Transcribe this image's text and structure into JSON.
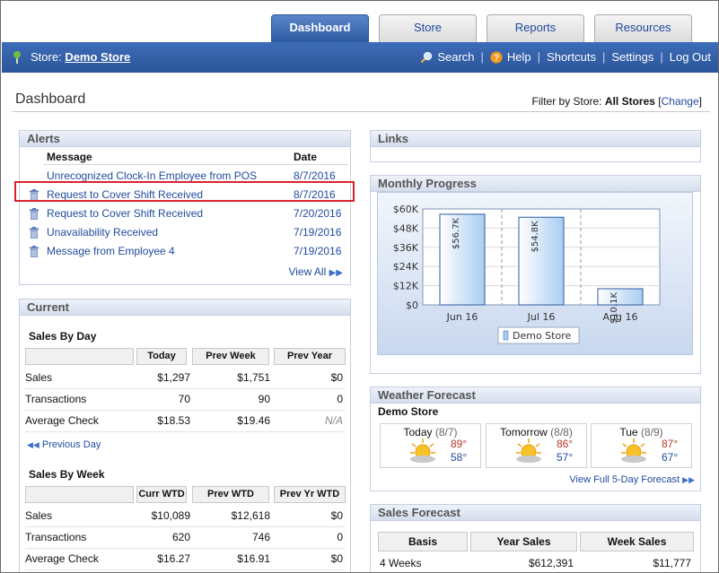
{
  "tabs": [
    {
      "label": "Dashboard",
      "active": true
    },
    {
      "label": "Store",
      "active": false
    },
    {
      "label": "Reports",
      "active": false
    },
    {
      "label": "Resources",
      "active": false
    }
  ],
  "nav": {
    "store_prefix": "Store:",
    "store_name": "Demo Store",
    "search": "Search",
    "help": "Help",
    "shortcuts": "Shortcuts",
    "settings": "Settings",
    "logout": "Log Out",
    "sep": "|"
  },
  "page": {
    "title": "Dashboard",
    "filter_prefix": "Filter by Store:",
    "filter_value": "All Stores",
    "filter_open": "[",
    "filter_change": "Change",
    "filter_close": "]"
  },
  "alerts": {
    "title": "Alerts",
    "col_message": "Message",
    "col_date": "Date",
    "rows": [
      {
        "message": "Unrecognized Clock-In Employee from POS",
        "date": "8/7/2016",
        "trash": false
      },
      {
        "message": "Request to Cover Shift Received",
        "date": "8/7/2016",
        "trash": true
      },
      {
        "message": "Request to Cover Shift Received",
        "date": "7/20/2016",
        "trash": true
      },
      {
        "message": "Unavailability Received",
        "date": "7/19/2016",
        "trash": true
      },
      {
        "message": "Message from Employee 4",
        "date": "7/19/2016",
        "trash": true
      }
    ],
    "view_all": "View All"
  },
  "links": {
    "title": "Links"
  },
  "current": {
    "title": "Current",
    "by_day": {
      "title": "Sales By Day",
      "headers": [
        "Today",
        "Prev Week",
        "Prev Year"
      ],
      "rows": [
        {
          "label": "Sales",
          "v": [
            "$1,297",
            "$1,751",
            "$0"
          ]
        },
        {
          "label": "Transactions",
          "v": [
            "70",
            "90",
            "0"
          ]
        },
        {
          "label": "Average Check",
          "v": [
            "$18.53",
            "$19.46",
            "N/A"
          ]
        }
      ],
      "prev_link": "Previous Day"
    },
    "by_week": {
      "title": "Sales By Week",
      "headers": [
        "Curr WTD",
        "Prev WTD",
        "Prev Yr WTD"
      ],
      "rows": [
        {
          "label": "Sales",
          "v": [
            "$10,089",
            "$12,618",
            "$0"
          ]
        },
        {
          "label": "Transactions",
          "v": [
            "620",
            "746",
            "0"
          ]
        },
        {
          "label": "Average Check",
          "v": [
            "$16.27",
            "$16.91",
            "$0"
          ]
        }
      ]
    }
  },
  "monthly": {
    "title": "Monthly Progress"
  },
  "chart_data": {
    "type": "bar",
    "categories": [
      "Jun 16",
      "Jul 16",
      "Aug 16"
    ],
    "series": [
      {
        "name": "Demo Store",
        "values": [
          56.7,
          54.8,
          10.1
        ]
      }
    ],
    "data_labels": [
      "$56.7K",
      "$54.8K",
      "$10.1K"
    ],
    "y_ticks": [
      "$0",
      "$12K",
      "$24K",
      "$36K",
      "$48K",
      "$60K"
    ],
    "ylim": [
      0,
      60
    ],
    "grid": true,
    "legend": "bottom-center"
  },
  "weather": {
    "title": "Weather Forecast",
    "store": "Demo Store",
    "days": [
      {
        "day": "Today",
        "date": "(8/7)",
        "hi": "89°",
        "lo": "58°"
      },
      {
        "day": "Tomorrow",
        "date": "(8/8)",
        "hi": "86°",
        "lo": "57°"
      },
      {
        "day": "Tue",
        "date": "(8/9)",
        "hi": "87°",
        "lo": "67°"
      }
    ],
    "view_link": "View Full 5-Day Forecast"
  },
  "sales_forecast": {
    "title": "Sales Forecast",
    "headers": [
      "Basis",
      "Year Sales",
      "Week Sales"
    ],
    "rows": [
      {
        "basis": "4 Weeks",
        "year": "$612,391",
        "week": "$11,777"
      }
    ]
  },
  "colors": {
    "accent": "#2f5aa3",
    "link": "#1f4a9e",
    "highlight": "#d9232e"
  }
}
